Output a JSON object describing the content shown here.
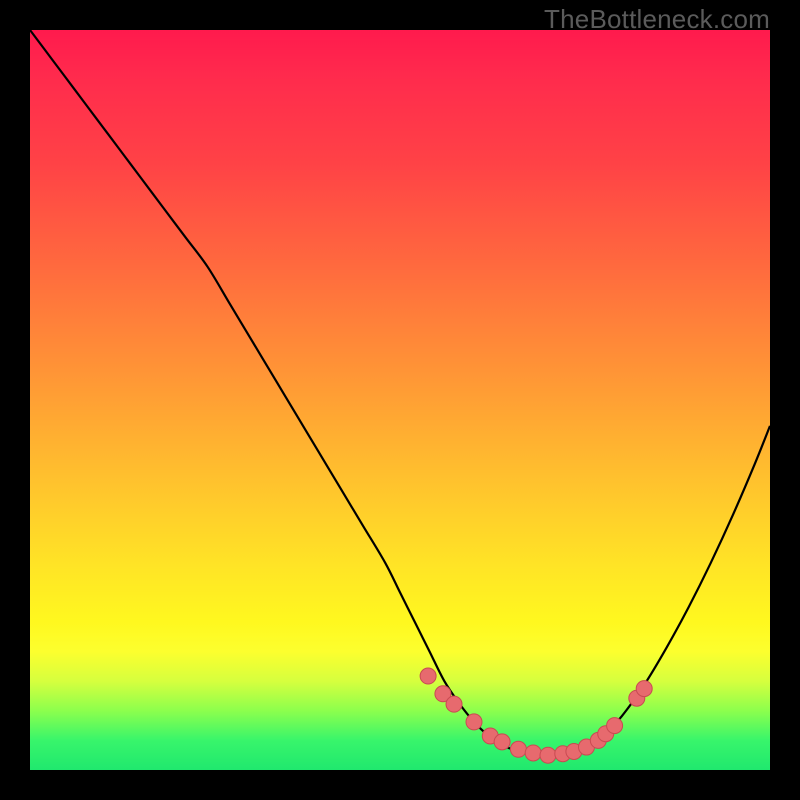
{
  "watermark": "TheBottleneck.com",
  "colors": {
    "curve": "#000000",
    "dots_fill": "#e76a6e",
    "dots_stroke": "#c94a52"
  },
  "chart_data": {
    "type": "line",
    "title": "",
    "xlabel": "",
    "ylabel": "",
    "xlim": [
      0,
      100
    ],
    "ylim": [
      0,
      100
    ],
    "series": [
      {
        "name": "bottleneck-curve",
        "x": [
          0,
          3,
          6,
          9,
          12,
          15,
          18,
          21,
          24,
          27,
          30,
          33,
          36,
          39,
          42,
          45,
          48,
          50,
          52,
          54,
          56,
          58,
          60,
          62,
          64,
          66,
          68,
          70,
          72,
          74,
          76,
          78,
          80,
          83,
          86,
          89,
          92,
          95,
          98,
          100
        ],
        "y": [
          100,
          96,
          92,
          88,
          84,
          80,
          76,
          72,
          68,
          63,
          58,
          53,
          48,
          43,
          38,
          33,
          28,
          24,
          20,
          16,
          12,
          9,
          6.5,
          4.6,
          3.3,
          2.5,
          2.1,
          2.0,
          2.2,
          2.7,
          3.7,
          5.2,
          7.3,
          11.5,
          16.5,
          22.0,
          28.0,
          34.5,
          41.5,
          46.5
        ]
      }
    ],
    "dots": {
      "name": "highlight-dots",
      "x": [
        53.8,
        55.8,
        57.3,
        60.0,
        62.2,
        63.8,
        66.0,
        68.0,
        70.0,
        72.0,
        73.5,
        75.2,
        76.8,
        77.8,
        79.0,
        82.0,
        83.0
      ],
      "y": [
        12.7,
        10.3,
        8.9,
        6.5,
        4.6,
        3.8,
        2.8,
        2.3,
        2.0,
        2.2,
        2.5,
        3.1,
        4.0,
        4.9,
        6.0,
        9.7,
        11.0
      ]
    }
  }
}
